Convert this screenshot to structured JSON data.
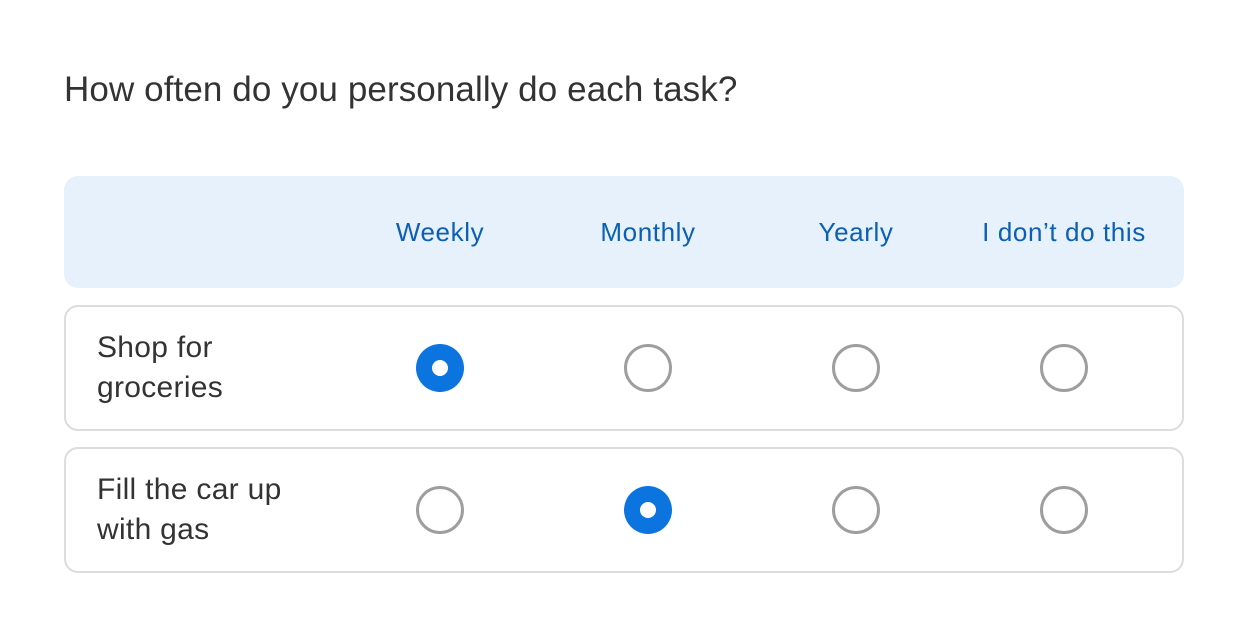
{
  "question": "How often do you personally do each task?",
  "columns": [
    {
      "label": "Weekly"
    },
    {
      "label": "Monthly"
    },
    {
      "label": "Yearly"
    },
    {
      "label": "I don’t do this"
    }
  ],
  "rows": [
    {
      "label": "Shop for groceries",
      "selected_index": 0,
      "selected_label": "Weekly"
    },
    {
      "label": "Fill the car up with gas",
      "selected_index": 1,
      "selected_label": "Monthly"
    }
  ],
  "colors": {
    "accent": "#0b74de",
    "header_background": "#e6f1fb",
    "header_text": "#0b5fb4",
    "radio_unselected_border": "#9e9e9e",
    "row_border": "#dcdcdc",
    "text": "#333333"
  }
}
